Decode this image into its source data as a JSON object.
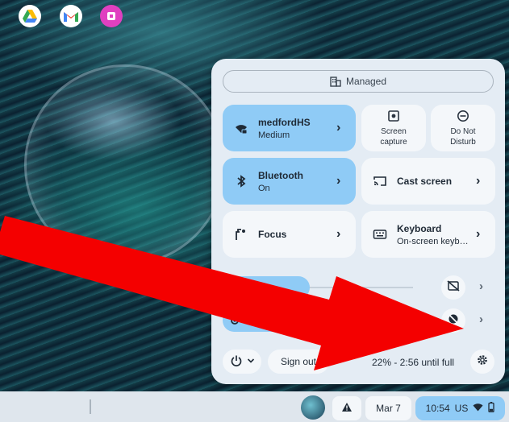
{
  "quick_settings": {
    "managed_label": "Managed",
    "network": {
      "name": "medfordHS",
      "status": "Medium"
    },
    "screen_capture": {
      "line1": "Screen",
      "line2": "capture"
    },
    "do_not_disturb": {
      "line1": "Do Not",
      "line2": "Disturb"
    },
    "bluetooth": {
      "name": "Bluetooth",
      "status": "On"
    },
    "cast": {
      "name": "Cast screen"
    },
    "focus": {
      "name": "Focus"
    },
    "keyboard": {
      "name": "Keyboard",
      "status": "On-screen keyb…"
    },
    "volume_level": 0.45,
    "brightness_level": 0.9,
    "sign_out_label": "Sign out",
    "battery_status": "22% - 2:56 until full"
  },
  "shelf": {
    "apps": [
      "google-drive-icon",
      "gmail-icon",
      "app-icon"
    ],
    "date": "Mar 7",
    "time": "10:54",
    "region": "US"
  },
  "colors": {
    "tile_on": "#8fcbf6",
    "panel_bg": "#e4ecf4",
    "annotation_arrow": "#f40000"
  }
}
